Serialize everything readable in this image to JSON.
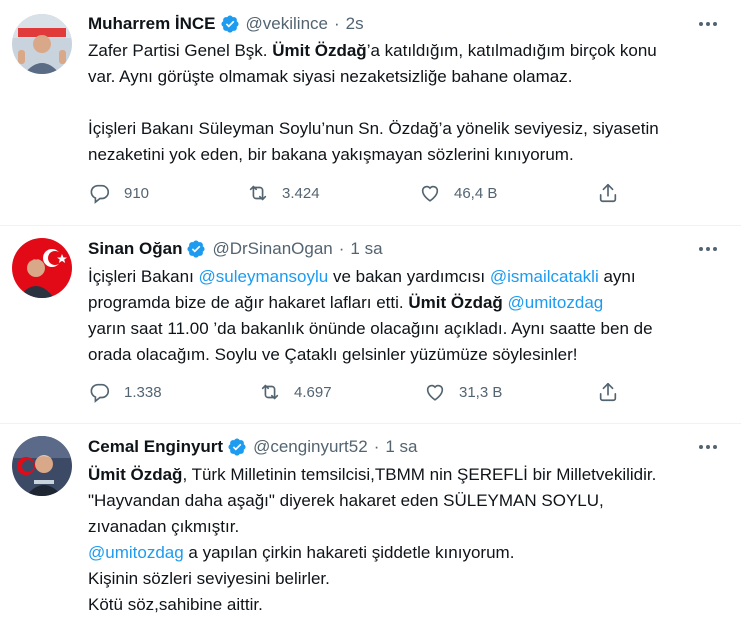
{
  "tweets": [
    {
      "name": "Muharrem İNCE",
      "handle": "@vekilince",
      "dot": "·",
      "time": "2s",
      "avatar_icon": "avatar-photo-muharrem-ince",
      "lines": [
        [
          {
            "t": "Zafer Partisi Genel Bşk. "
          },
          {
            "t": "Ümit Özdağ",
            "b": true
          },
          {
            "t": "’a katıldığım, katılmadığım birçok konu"
          }
        ],
        [
          {
            "t": "var. Aynı görüşte olmamak siyasi nezaketsizliğe bahane olamaz."
          }
        ],
        [],
        [
          {
            "t": "İçişleri Bakanı Süleyman Soylu’nun Sn. Özdağ’a yönelik seviyesiz, siyasetin"
          }
        ],
        [
          {
            "t": "nezaketini yok eden, bir bakana yakışmayan sözlerini kınıyorum."
          }
        ]
      ],
      "replies": "910",
      "retweets": "3.424",
      "likes": "46,4 B"
    },
    {
      "name": "Sinan Oğan",
      "handle": "@DrSinanOgan",
      "dot": "·",
      "time": "1 sa",
      "avatar_icon": "avatar-photo-sinan-ogan",
      "lines": [
        [
          {
            "t": "İçişleri Bakanı "
          },
          {
            "t": "@suleymansoylu",
            "m": true
          },
          {
            "t": " ve bakan yardımcısı "
          },
          {
            "t": "@ismailcatakli",
            "m": true
          },
          {
            "t": " aynı"
          }
        ],
        [
          {
            "t": "programda bize de ağır hakaret lafları etti. "
          },
          {
            "t": "Ümit Özdağ",
            "b": true
          },
          {
            "t": " "
          },
          {
            "t": "@umitozdag",
            "m": true
          }
        ],
        [
          {
            "t": "yarın saat 11.00 ’da bakanlık önünde olacağını açıkladı. Aynı saatte ben de"
          }
        ],
        [
          {
            "t": "orada olacağım. Soylu ve Çataklı gelsinler yüzümüze söylesinler!"
          }
        ]
      ],
      "replies": "1.338",
      "retweets": "4.697",
      "likes": "31,3 B"
    },
    {
      "name": "Cemal Enginyurt",
      "handle": "@cenginyurt52",
      "dot": "·",
      "time": "1 sa",
      "avatar_icon": "avatar-photo-cemal-enginyurt",
      "lines": [
        [
          {
            "t": "Ümit Özdağ",
            "b": true
          },
          {
            "t": ", Türk Milletinin temsilcisi,TBMM nin ŞEREFLİ bir Milletvekilidir."
          }
        ],
        [
          {
            "t": "\"Hayvandan daha aşağı\" diyerek hakaret eden SÜLEYMAN SOYLU,"
          }
        ],
        [
          {
            "t": "zıvanadan çıkmıştır."
          }
        ],
        [
          {
            "t": "@umitozdag",
            "m": true
          },
          {
            "t": " a yapılan çirkin hakareti şiddetle kınıyorum."
          }
        ],
        [
          {
            "t": "Kişinin sözleri seviyesini belirler."
          }
        ],
        [
          {
            "t": "Kötü söz,sahibine aittir."
          }
        ]
      ]
    }
  ],
  "colors": {
    "text": "#0f1419",
    "secondary": "#536471",
    "accent": "#1d9bf0",
    "divider": "#eff3f4"
  },
  "icons": [
    "more-icon",
    "verified-badge-icon",
    "reply-icon",
    "retweet-icon",
    "like-icon",
    "share-icon"
  ]
}
